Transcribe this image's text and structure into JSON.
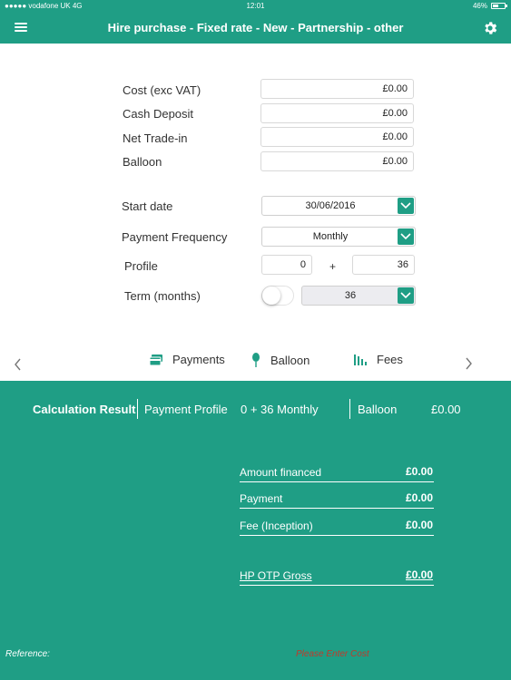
{
  "status_bar": {
    "carrier": "●●●●● vodafone UK  4G",
    "time": "12:01",
    "battery": "46%"
  },
  "nav": {
    "title": "Hire purchase - Fixed rate - New - Partnership - other"
  },
  "form": {
    "cost": {
      "label": "Cost (exc VAT)",
      "value": "£0.00"
    },
    "cash_deposit": {
      "label": "Cash Deposit",
      "value": "£0.00"
    },
    "net_trade_in": {
      "label": "Net Trade-in",
      "value": "£0.00"
    },
    "balloon": {
      "label": "Balloon",
      "value": "£0.00"
    },
    "start_date": {
      "label": "Start date",
      "value": "30/06/2016"
    },
    "payment_frequency": {
      "label": "Payment Frequency",
      "value": "Monthly"
    },
    "profile": {
      "label": "Profile",
      "upfront": "0",
      "plus": "+",
      "remaining": "36"
    },
    "term": {
      "label": "Term (months)",
      "value": "36"
    }
  },
  "tabs": [
    {
      "label": "Payments"
    },
    {
      "label": "Balloon"
    },
    {
      "label": "Fees"
    }
  ],
  "result": {
    "title": "Calculation Result",
    "payment_profile_label": "Payment Profile",
    "payment_profile_value": "0 + 36 Monthly",
    "balloon_label": "Balloon",
    "balloon_value": "£0.00",
    "rows": [
      {
        "label": "Amount financed",
        "value": "£0.00"
      },
      {
        "label": "Payment",
        "value": "£0.00"
      },
      {
        "label": "Fee (Inception)",
        "value": "£0.00"
      },
      {
        "label": "HP OTP Gross",
        "value": "£0.00"
      }
    ],
    "reference_label": "Reference:",
    "warning": "Please Enter Cost"
  },
  "colors": {
    "accent": "#1f9e85",
    "warning": "#c0392b"
  }
}
